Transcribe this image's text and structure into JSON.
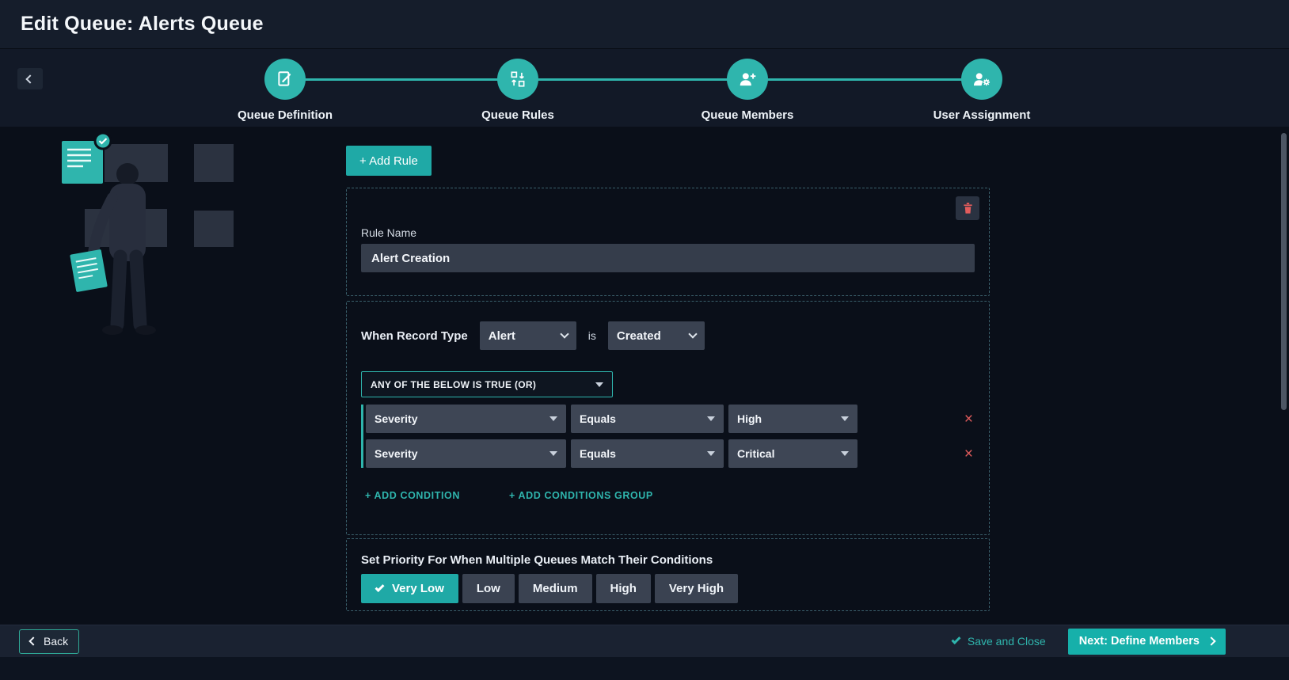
{
  "header": {
    "title": "Edit Queue: Alerts Queue"
  },
  "stepper": {
    "steps": [
      {
        "label": "Queue Definition"
      },
      {
        "label": "Queue Rules"
      },
      {
        "label": "Queue Members"
      },
      {
        "label": "User Assignment"
      }
    ]
  },
  "rules": {
    "add_rule_label": "+ Add Rule",
    "rule": {
      "name_label": "Rule Name",
      "name_value": "Alert Creation",
      "when_label": "When Record Type",
      "record_type_value": "Alert",
      "is_label": "is",
      "event_value": "Created",
      "group_operator": "ANY OF THE BELOW IS TRUE (OR)",
      "conditions": [
        {
          "field": "Severity",
          "operator": "Equals",
          "value": "High"
        },
        {
          "field": "Severity",
          "operator": "Equals",
          "value": "Critical"
        }
      ],
      "add_condition_label": "+ ADD CONDITION",
      "add_group_label": "+ ADD CONDITIONS GROUP"
    },
    "priority": {
      "label": "Set Priority For When Multiple Queues Match Their Conditions",
      "options": [
        "Very Low",
        "Low",
        "Medium",
        "High",
        "Very High"
      ],
      "selected": "Very Low"
    }
  },
  "footer": {
    "back_label": "Back",
    "save_label": "Save and Close",
    "next_label": "Next: Define Members"
  },
  "icons": {
    "remove": "×"
  },
  "colors": {
    "accent": "#2fb5ad",
    "danger": "#e25c5c"
  }
}
